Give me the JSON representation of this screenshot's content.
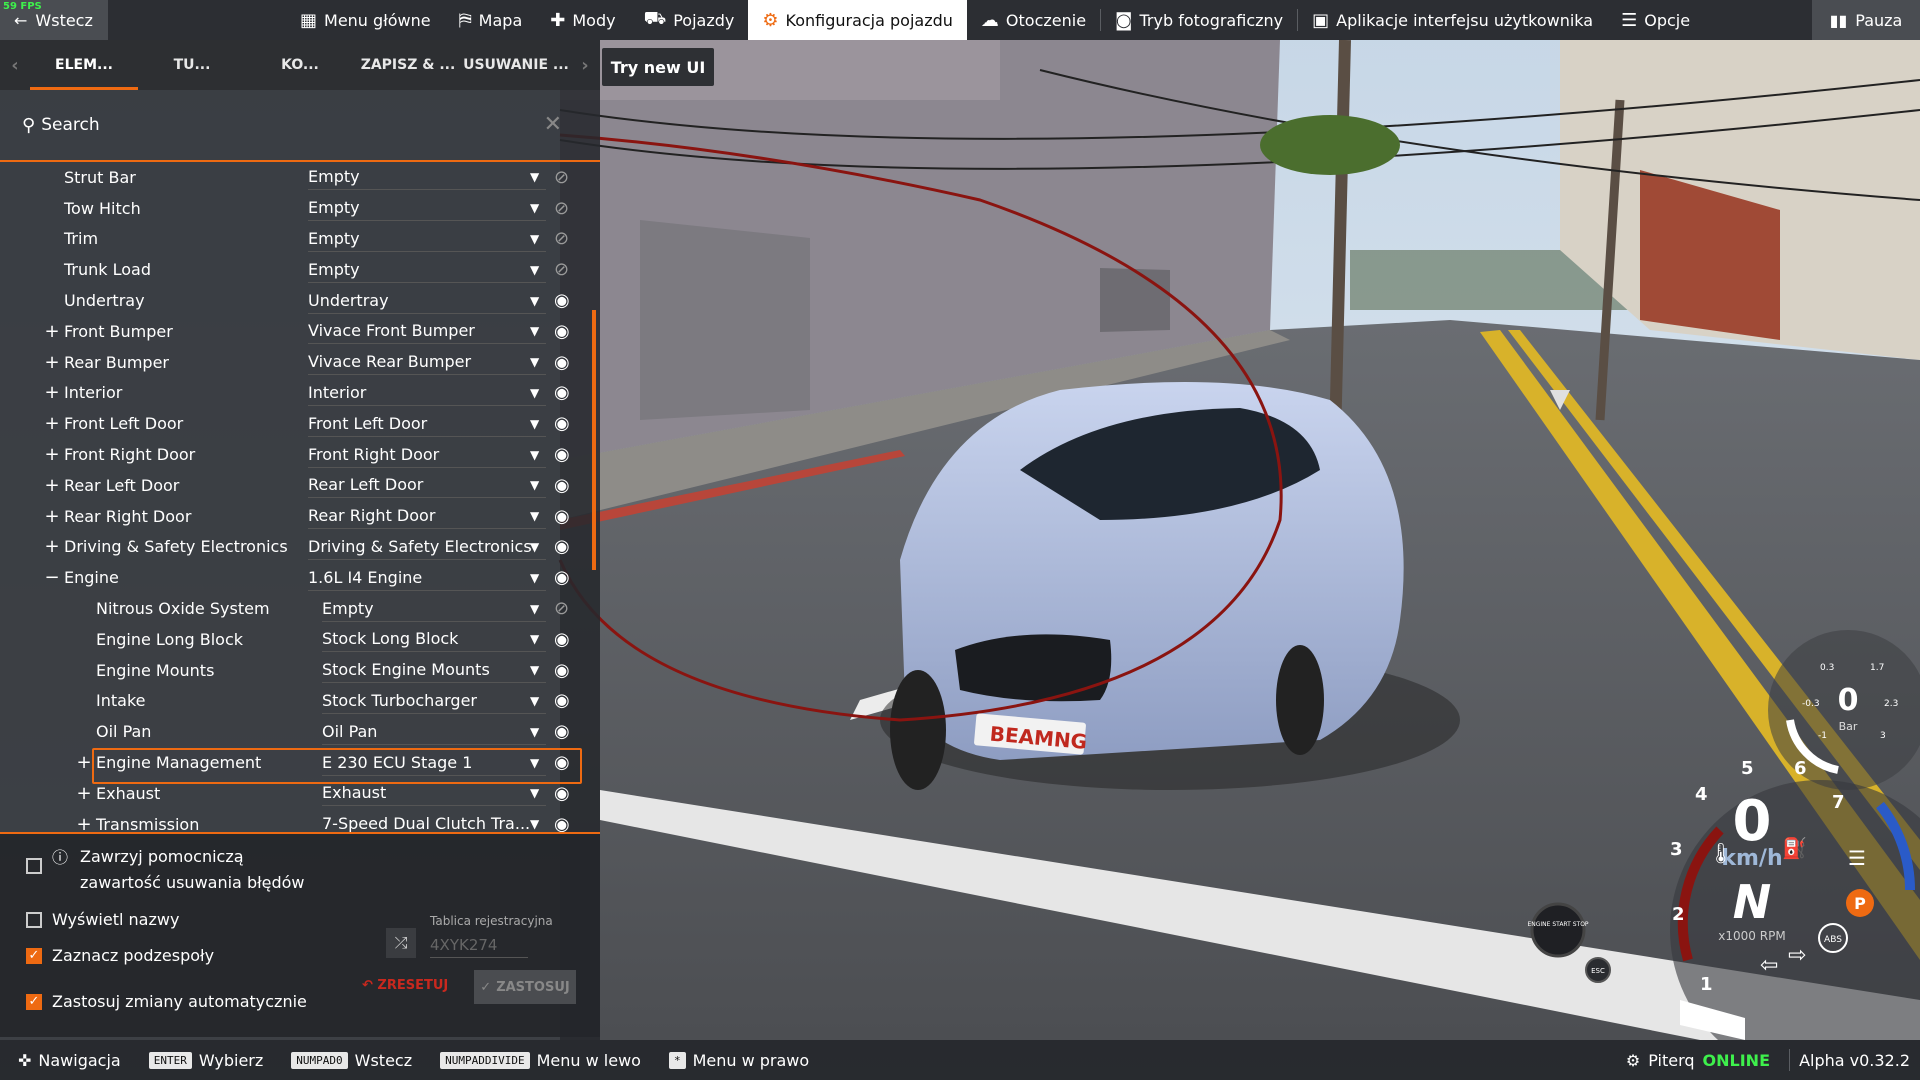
{
  "fps": "59 FPS",
  "topbar": {
    "back_label": "Wstecz",
    "menu": [
      {
        "label": "Menu główne",
        "icon": "grid-icon"
      },
      {
        "label": "Mapa",
        "icon": "map-icon"
      },
      {
        "label": "Mody",
        "icon": "puzzle-icon"
      },
      {
        "label": "Pojazdy",
        "icon": "car-icon"
      },
      {
        "label": "Konfiguracja pojazdu",
        "icon": "engine-icon"
      },
      {
        "label": "Otoczenie",
        "icon": "weather-icon"
      },
      {
        "label": "Tryb fotograficzny",
        "icon": "camera-icon"
      },
      {
        "label": "Aplikacje interfejsu użytkownika",
        "icon": "apps-icon"
      },
      {
        "label": "Opcje",
        "icon": "sliders-icon"
      }
    ],
    "pause_label": "Pauza"
  },
  "tabs": [
    "ELEM...",
    "TU...",
    "KO...",
    "ZAPISZ & ...",
    "USUWANIE ..."
  ],
  "try_new_ui": "Try new UI",
  "search": {
    "label": "Search"
  },
  "parts": [
    {
      "name": "Strut Bar",
      "value": "Empty",
      "level": 0,
      "expand": "",
      "visible": false
    },
    {
      "name": "Tow Hitch",
      "value": "Empty",
      "level": 0,
      "expand": "",
      "visible": false
    },
    {
      "name": "Trim",
      "value": "Empty",
      "level": 0,
      "expand": "",
      "visible": false
    },
    {
      "name": "Trunk Load",
      "value": "Empty",
      "level": 0,
      "expand": "",
      "visible": false
    },
    {
      "name": "Undertray",
      "value": "Undertray",
      "level": 0,
      "expand": "",
      "visible": true
    },
    {
      "name": "Front Bumper",
      "value": "Vivace Front Bumper",
      "level": 0,
      "expand": "+",
      "visible": true
    },
    {
      "name": "Rear Bumper",
      "value": "Vivace Rear Bumper",
      "level": 0,
      "expand": "+",
      "visible": true
    },
    {
      "name": "Interior",
      "value": "Interior",
      "level": 0,
      "expand": "+",
      "visible": true
    },
    {
      "name": "Front Left Door",
      "value": "Front Left Door",
      "level": 0,
      "expand": "+",
      "visible": true
    },
    {
      "name": "Front Right Door",
      "value": "Front Right Door",
      "level": 0,
      "expand": "+",
      "visible": true
    },
    {
      "name": "Rear Left Door",
      "value": "Rear Left Door",
      "level": 0,
      "expand": "+",
      "visible": true
    },
    {
      "name": "Rear Right Door",
      "value": "Rear Right Door",
      "level": 0,
      "expand": "+",
      "visible": true
    },
    {
      "name": "Driving & Safety Electronics",
      "value": "Driving & Safety Electronics",
      "level": 0,
      "expand": "+",
      "visible": true
    },
    {
      "name": "Engine",
      "value": "1.6L I4 Engine",
      "level": 0,
      "expand": "−",
      "visible": true
    },
    {
      "name": "Nitrous Oxide System",
      "value": "Empty",
      "level": 1,
      "expand": "",
      "visible": false
    },
    {
      "name": "Engine Long Block",
      "value": "Stock Long Block",
      "level": 1,
      "expand": "",
      "visible": true
    },
    {
      "name": "Engine Mounts",
      "value": "Stock Engine Mounts",
      "level": 1,
      "expand": "",
      "visible": true
    },
    {
      "name": "Intake",
      "value": "Stock Turbocharger",
      "level": 1,
      "expand": "",
      "visible": true
    },
    {
      "name": "Oil Pan",
      "value": "Oil Pan",
      "level": 1,
      "expand": "",
      "visible": true
    },
    {
      "name": "Engine Management",
      "value": "E 230 ECU Stage 1",
      "level": 1,
      "expand": "+",
      "visible": true,
      "highlight": true
    },
    {
      "name": "Exhaust",
      "value": "Exhaust",
      "level": 1,
      "expand": "+",
      "visible": true
    },
    {
      "name": "Transmission",
      "value": "7-Speed Dual Clutch Tra...",
      "level": 1,
      "expand": "+",
      "visible": true
    }
  ],
  "options": {
    "include_debug": "Zawrzyj pomocniczą zawartość usuwania błędów",
    "show_names": "Wyświetl nazwy",
    "mark_subparts": "Zaznacz podzespoły",
    "auto_apply": "Zastosuj zmiany automatycznie",
    "plate_label": "Tablica rejestracyjna",
    "plate_value": "4XYK274",
    "reset_label": "ZRESETUJ",
    "apply_label": "ZASTOSUJ"
  },
  "bottombar": {
    "nav": "Nawigacja",
    "hints": [
      {
        "key": "ENTER",
        "label": "Wybierz"
      },
      {
        "key": "NUMPAD0",
        "label": "Wstecz"
      },
      {
        "key": "NUMPADDIVIDE",
        "label": "Menu w lewo"
      },
      {
        "key": "*",
        "label": "Menu w prawo"
      }
    ],
    "user": "Piterq",
    "status": "ONLINE",
    "version": "Alpha v0.32.2"
  },
  "hud": {
    "boost_value": "0",
    "boost_unit": "Bar",
    "boost_ticks": [
      "0.3",
      "1.7",
      "-0.3",
      "2.3",
      "-1",
      "3"
    ],
    "speed": "0",
    "speed_unit": "km/h",
    "gear": "N",
    "rpm_unit": "x1000 RPM",
    "rpm_ticks": [
      "1",
      "2",
      "3",
      "4",
      "5",
      "6",
      "7"
    ],
    "start_stop": "ENGINE START STOP",
    "esc": "ESC",
    "abs": "ABS",
    "parking": "P",
    "plate_text": "BEAMNG"
  }
}
